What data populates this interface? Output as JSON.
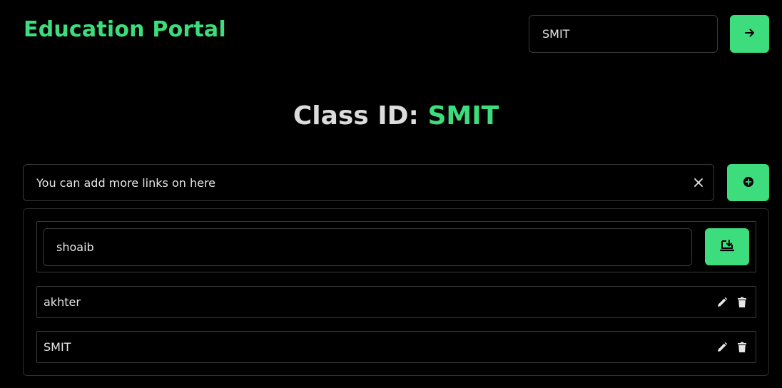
{
  "header": {
    "brand": "Education Portal",
    "class_input_value": "SMIT",
    "go_icon": "arrow-right-icon"
  },
  "main": {
    "heading_prefix": "Class ID:",
    "heading_value": "SMIT",
    "link_input_placeholder": "You can add more links on here",
    "clear_icon": "close-icon",
    "add_icon": "plus-circle-icon"
  },
  "list": {
    "editing": {
      "value": "shoaib",
      "save_icon": "save-download-icon"
    },
    "items": [
      {
        "label": "akhter",
        "edit_icon": "pencil-icon",
        "delete_icon": "trash-icon"
      },
      {
        "label": "SMIT",
        "edit_icon": "pencil-icon",
        "delete_icon": "trash-icon"
      }
    ]
  },
  "colors": {
    "accent": "#3ddc7c",
    "background": "#000000",
    "text": "#e6e6e6",
    "border": "#3a3a3a"
  }
}
